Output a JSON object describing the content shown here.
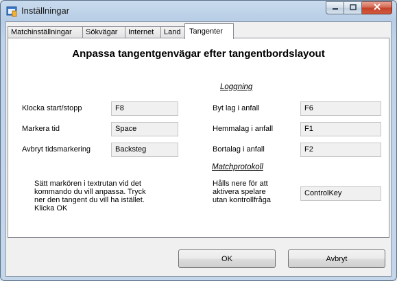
{
  "window": {
    "title": "Inställningar",
    "icons": {
      "app": "settings-window-icon",
      "minimize": "minimize-icon",
      "maximize": "maximize-icon",
      "close": "close-icon"
    }
  },
  "tabs": [
    "Matchinställningar",
    "Sökvägar",
    "Internet",
    "Land",
    "Tangenter"
  ],
  "active_tab": "Tangenter",
  "page": {
    "heading": "Anpassa tangentgenvägar efter tangentbordslayout",
    "logging_section": "Loggning",
    "protocol_section": "Matchprotokoll",
    "left_rows": [
      {
        "label": "Klocka start/stopp",
        "value": "F8"
      },
      {
        "label": "Markera tid",
        "value": "Space"
      },
      {
        "label": "Avbryt tidsmarkering",
        "value": "Backsteg"
      }
    ],
    "right_rows": [
      {
        "label": "Byt lag i anfall",
        "value": "F6"
      },
      {
        "label": "Hemmalag i anfall",
        "value": "F1"
      },
      {
        "label": "Bortalag i anfall",
        "value": "F2"
      }
    ],
    "instructions": [
      "Sätt markören i textrutan vid det",
      "kommando du vill anpassa. Tryck",
      "ner den tangent du vill ha istället.",
      "Klicka OK"
    ],
    "hold_label": [
      "Hålls nere för att",
      "aktivera spelare",
      "utan kontrollfråga"
    ],
    "hold_value": "ControlKey"
  },
  "buttons": {
    "ok": "OK",
    "cancel": "Avbryt"
  },
  "colors": {
    "title_bar": "#b7cde5",
    "close_button": "#c3412a",
    "field_bg": "#f0f0f0"
  }
}
